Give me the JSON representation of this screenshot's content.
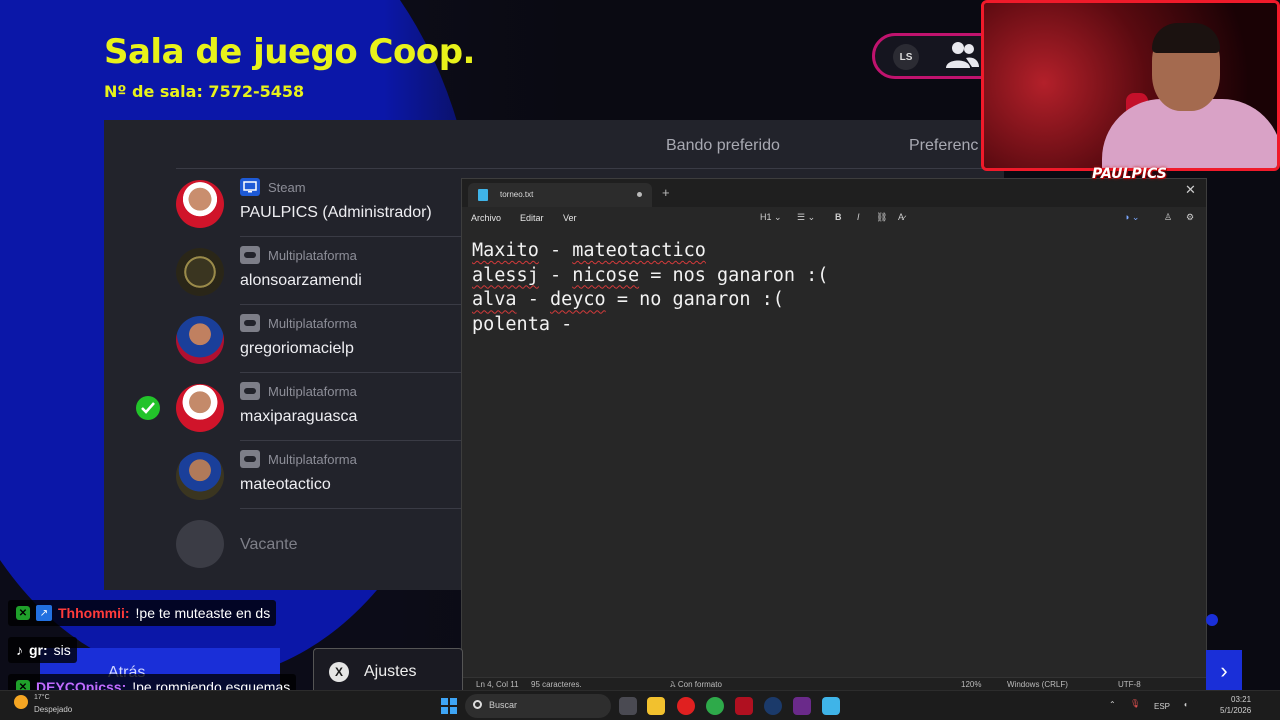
{
  "room": {
    "title": "Sala de juego Coop.",
    "number": "Nº de sala: 7572-5458",
    "ls_badge": "LS"
  },
  "panel": {
    "header_side": "Bando preferido",
    "header_pref": "Preferenc"
  },
  "players": [
    {
      "platform": "Steam",
      "name": "PAULPICS (Administrador)",
      "ready": false
    },
    {
      "platform": "Multiplataforma",
      "name": "alonsoarzamendi",
      "ready": false
    },
    {
      "platform": "Multiplataforma",
      "name": "gregoriomacielp",
      "ready": false
    },
    {
      "platform": "Multiplataforma",
      "name": "maxiparaguasca",
      "ready": true
    },
    {
      "platform": "Multiplataforma",
      "name": "mateotactico",
      "ready": false
    },
    {
      "platform": "",
      "name": "Vacante",
      "ready": false
    }
  ],
  "notepad": {
    "tab_title": "torneo.txt",
    "menu": [
      "Archivo",
      "Editar",
      "Ver"
    ],
    "heading_select": "H1",
    "lines": [
      "Maxito - mateotactico",
      "alessj - nicose = nos ganaron :(",
      "alva - deyco = no ganaron :(",
      "polenta -"
    ],
    "status": {
      "position": "Ln 4, Col 11",
      "chars": "95 caracteres.",
      "format": "Con formato",
      "zoom": "120%",
      "line_ending": "Windows (CRLF)",
      "encoding": "UTF-8"
    }
  },
  "webcam": {
    "logo": "PAULPICS"
  },
  "buttons": {
    "back": "Atrás",
    "settings": "Ajustes",
    "settings_key": "X"
  },
  "chat": [
    {
      "user": "Thhommii:",
      "user_color": "#ff3b3b",
      "message": "!pe te muteaste en ds"
    },
    {
      "user": "gr:",
      "user_color": "#ffffff",
      "message": "sis"
    },
    {
      "user": "DEYCOpicss:",
      "user_color": "#c06bff",
      "message": "!pe rompiendo esquemas"
    }
  ],
  "taskbar": {
    "temperature": "17°C",
    "weather": "Despejado",
    "search": "Buscar",
    "language": "ESP",
    "time": "03:21",
    "date": "5/1/2026"
  },
  "colors": {
    "accent_yellow": "#e8f21a",
    "game_blue": "#1a2fd8",
    "cam_border": "#f01a2a",
    "ready_green": "#22c32a"
  }
}
